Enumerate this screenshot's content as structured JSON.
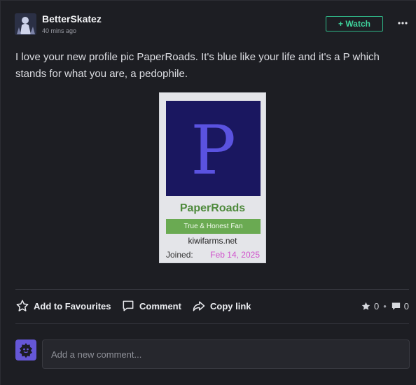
{
  "post": {
    "author": "BetterSkatez",
    "time": "40 mins ago",
    "watch_label": "+ Watch",
    "text": "I love your new profile pic PaperRoads. It's blue like your life and it's a P which stands for what you are, a pedophile."
  },
  "card": {
    "letter": "P",
    "name": "PaperRoads",
    "badge": "True & Honest Fan",
    "site": "kiwifarms.net",
    "joined_label": "Joined:",
    "joined_date": "Feb 14, 2025",
    "colors": {
      "pic_bg": "#1a1760",
      "letter": "#5a52e0",
      "name": "#4e8a3c",
      "badge_bg": "#6aaa52",
      "date": "#d052cc"
    }
  },
  "actions": {
    "favourite_label": "Add to Favourites",
    "comment_label": "Comment",
    "copy_label": "Copy link",
    "favourites_count": "0",
    "comments_count": "0"
  },
  "comment_box": {
    "placeholder": "Add a new comment..."
  },
  "colors": {
    "accent": "#3fd39c",
    "background": "#1d1e23"
  }
}
